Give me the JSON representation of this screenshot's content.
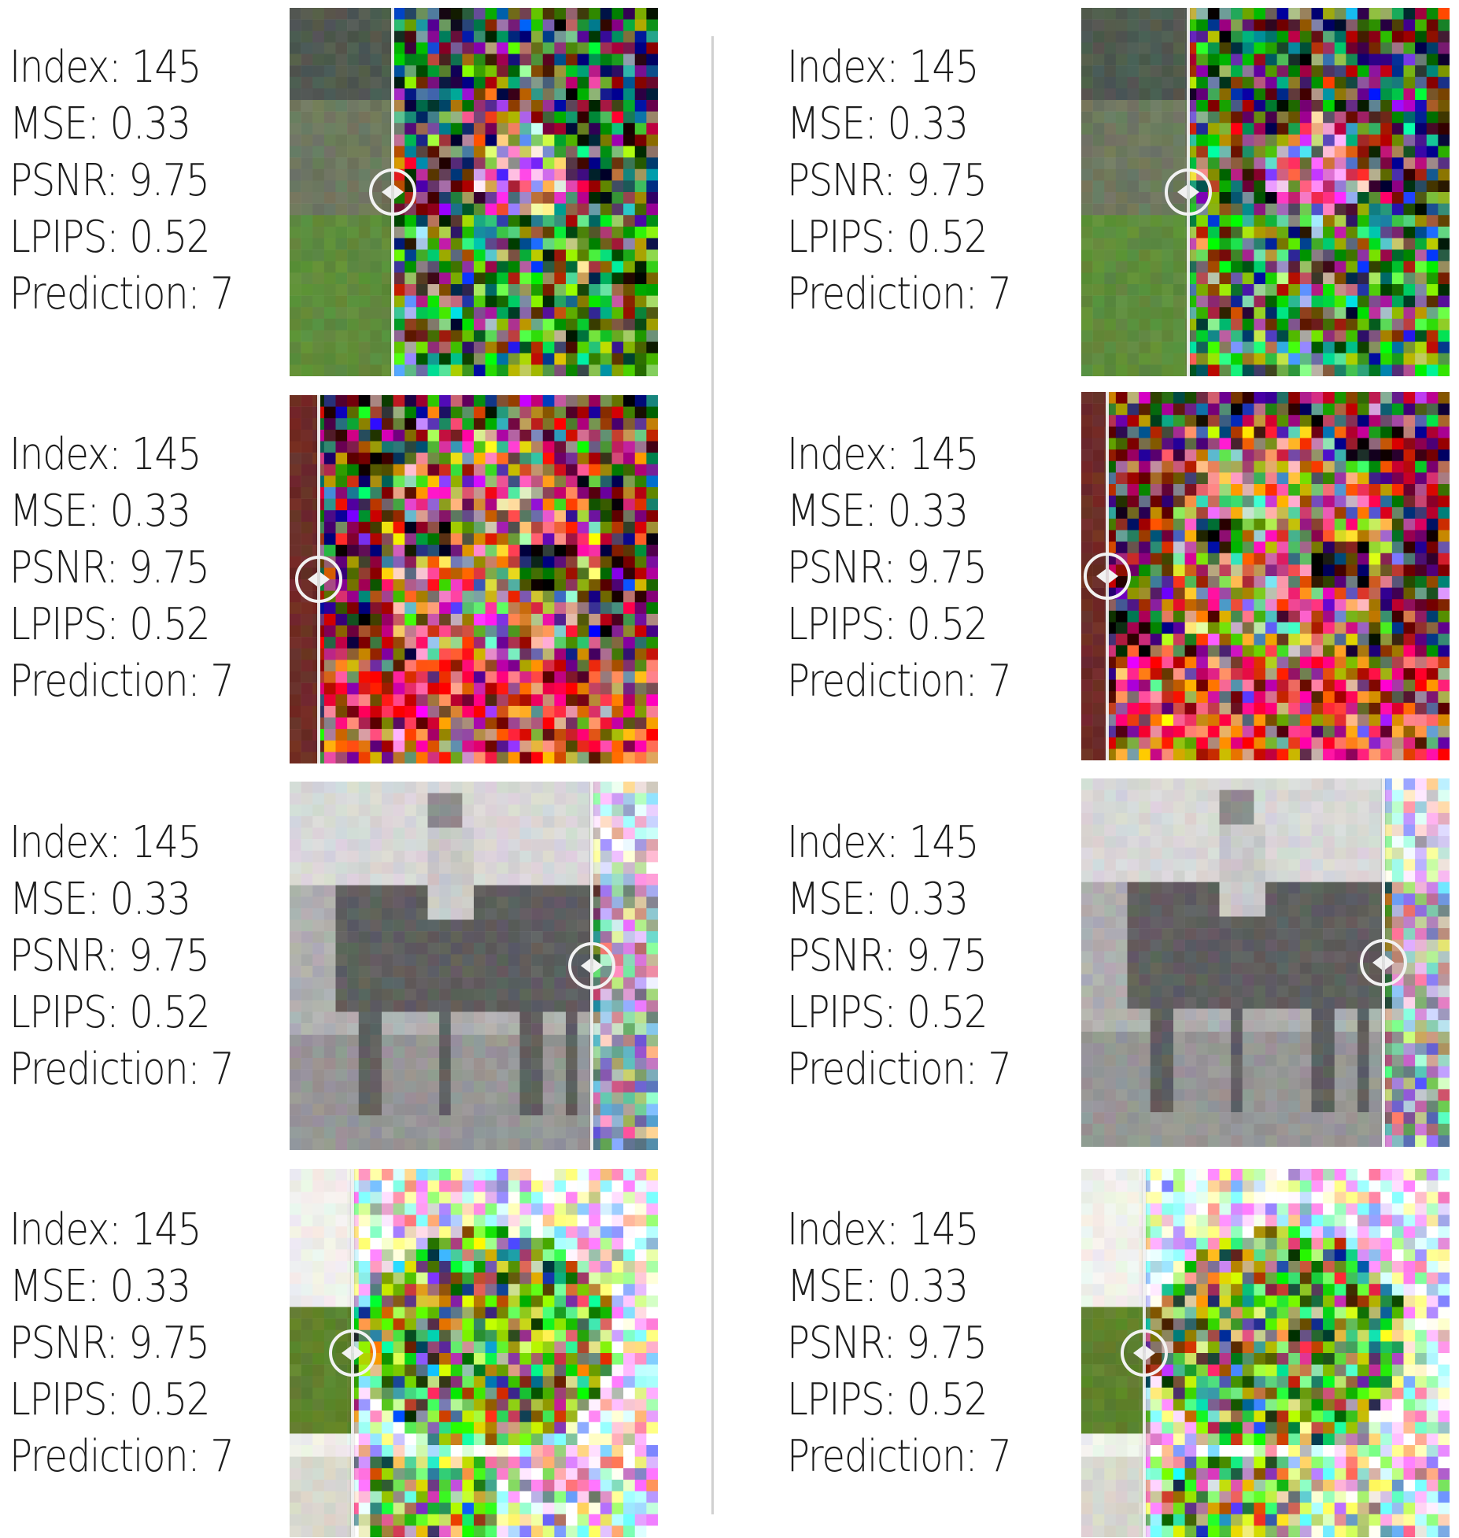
{
  "cards": [
    {
      "index_text": "Index: 145",
      "mse_text": "MSE: 0.33",
      "psnr_text": "PSNR: 9.75",
      "lpips_text": "LPIPS: 0.52",
      "prediction_text": "Prediction: 7",
      "scene": "flower",
      "split": 0.28
    },
    {
      "index_text": "Index: 145",
      "mse_text": "MSE: 0.33",
      "psnr_text": "PSNR: 9.75",
      "lpips_text": "LPIPS: 0.52",
      "prediction_text": "Prediction: 7",
      "scene": "flower",
      "split": 0.29
    },
    {
      "index_text": "Index: 145",
      "mse_text": "MSE: 0.33",
      "psnr_text": "PSNR: 9.75",
      "lpips_text": "LPIPS: 0.52",
      "prediction_text": "Prediction: 7",
      "scene": "face",
      "split": 0.08
    },
    {
      "index_text": "Index: 145",
      "mse_text": "MSE: 0.33",
      "psnr_text": "PSNR: 9.75",
      "lpips_text": "LPIPS: 0.52",
      "prediction_text": "Prediction: 7",
      "scene": "face",
      "split": 0.07
    },
    {
      "index_text": "Index: 145",
      "mse_text": "MSE: 0.33",
      "psnr_text": "PSNR: 9.75",
      "lpips_text": "LPIPS: 0.52",
      "prediction_text": "Prediction: 7",
      "scene": "horse",
      "split": 0.82
    },
    {
      "index_text": "Index: 145",
      "mse_text": "MSE: 0.33",
      "psnr_text": "PSNR: 9.75",
      "lpips_text": "LPIPS: 0.52",
      "prediction_text": "Prediction: 7",
      "scene": "horse",
      "split": 0.82
    },
    {
      "index_text": "Index: 145",
      "mse_text": "MSE: 0.33",
      "psnr_text": "PSNR: 9.75",
      "lpips_text": "LPIPS: 0.52",
      "prediction_text": "Prediction: 7",
      "scene": "frog",
      "split": 0.17
    },
    {
      "index_text": "Index: 145",
      "mse_text": "MSE: 0.33",
      "psnr_text": "PSNR: 9.75",
      "lpips_text": "LPIPS: 0.52",
      "prediction_text": "Prediction: 7",
      "scene": "frog",
      "split": 0.17
    }
  ],
  "colors": {
    "divider": "#d0d0d0",
    "handle": "#f2f2f2",
    "text": "#1d1d1d"
  },
  "icons": {
    "handle": "left-right-arrows-icon"
  }
}
